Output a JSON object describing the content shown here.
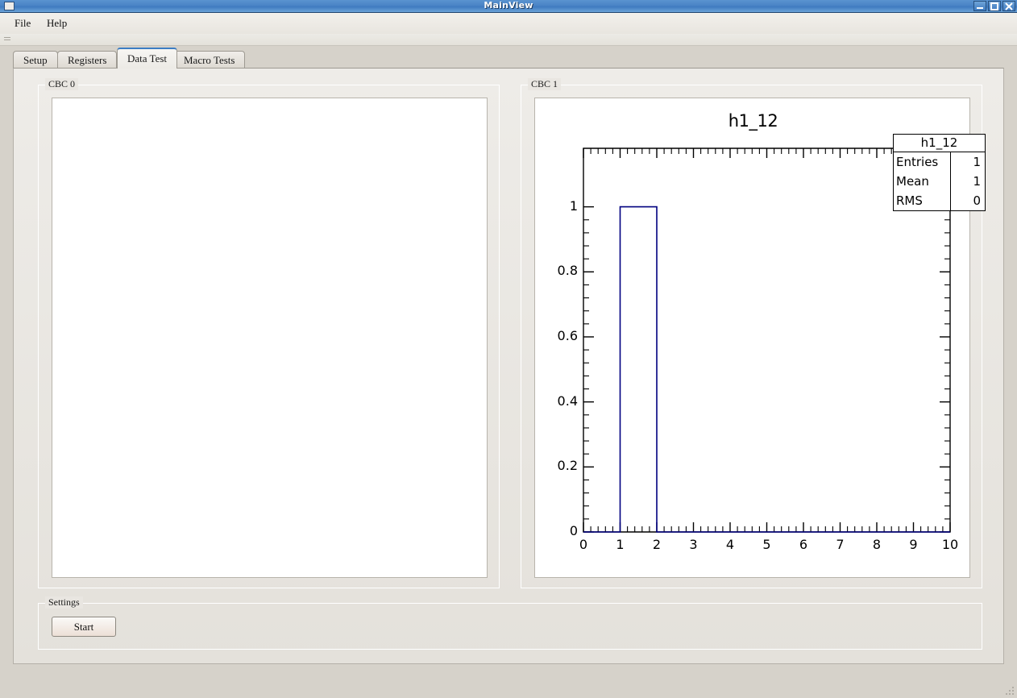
{
  "window": {
    "title": "MainView",
    "icon": "app-icon",
    "controls": [
      {
        "name": "minimize-button",
        "glyph": "minimize"
      },
      {
        "name": "maximize-button",
        "glyph": "maximize"
      },
      {
        "name": "close-button",
        "glyph": "close"
      }
    ]
  },
  "menubar": {
    "items": [
      {
        "label": "File"
      },
      {
        "label": "Help"
      }
    ]
  },
  "tabs": [
    {
      "label": "Setup",
      "selected": false
    },
    {
      "label": "Registers",
      "selected": false
    },
    {
      "label": "Data Test",
      "selected": true
    },
    {
      "label": "Macro Tests",
      "selected": false
    }
  ],
  "groups": {
    "cbc0": {
      "title": "CBC 0"
    },
    "cbc1": {
      "title": "CBC 1"
    },
    "settings": {
      "title": "Settings"
    }
  },
  "buttons": {
    "start": "Start"
  },
  "colors": {
    "titlebar": "#4a84c6",
    "tab_accent": "#3c7dc4",
    "panel_bg": "#e9e6e1",
    "histogram_line": "#000080",
    "axis": "#000000"
  },
  "chart_data": {
    "type": "bar",
    "title": "h1_12",
    "xlabel": "",
    "ylabel": "",
    "xlim": [
      0,
      10
    ],
    "ylim": [
      0,
      1.18
    ],
    "x_ticks": [
      0,
      1,
      2,
      3,
      4,
      5,
      6,
      7,
      8,
      9,
      10
    ],
    "x_tick_labels": [
      "0",
      "1",
      "2",
      "3",
      "4",
      "5",
      "6",
      "7",
      "8",
      "9",
      "10"
    ],
    "x_minor_per_major": 5,
    "y_ticks": [
      0,
      0.2,
      0.4,
      0.6,
      0.8,
      1
    ],
    "y_tick_labels": [
      "0",
      "0.2",
      "0.4",
      "0.6",
      "0.8",
      "1"
    ],
    "y_minor_per_major": 5,
    "grid": false,
    "bin_width": 1,
    "bin_edges": [
      0,
      1,
      2,
      3,
      4,
      5,
      6,
      7,
      8,
      9,
      10
    ],
    "values": [
      0,
      1,
      0,
      0,
      0,
      0,
      0,
      0,
      0,
      0
    ],
    "line_color": "#000080",
    "fill": "none",
    "stats": {
      "name": "h1_12",
      "rows": [
        {
          "label": "Entries",
          "value": "1"
        },
        {
          "label": "Mean",
          "value": "1"
        },
        {
          "label": "RMS",
          "value": "0"
        }
      ]
    }
  }
}
